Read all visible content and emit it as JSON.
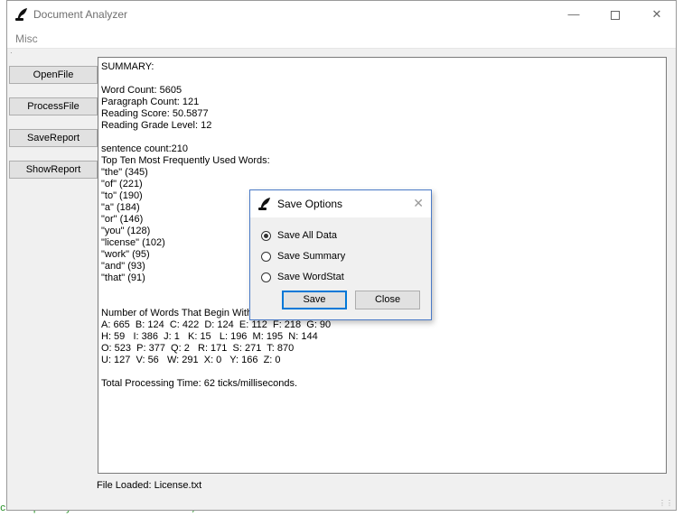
{
  "window": {
    "title": "Document Analyzer"
  },
  "menu": {
    "misc": "Misc"
  },
  "buttons": {
    "open_file": "OpenFile",
    "process_file": "ProcessFile",
    "save_report": "SaveReport",
    "show_report": "ShowReport"
  },
  "report": {
    "lines": [
      "SUMMARY:",
      "",
      "Word Count: 5605",
      "Paragraph Count: 121",
      "Reading Score: 50.5877",
      "Reading Grade Level: 12",
      "",
      "sentence count:210",
      "Top Ten Most Frequently Used Words:",
      "\"the\" (345)",
      "\"of\" (221)",
      "\"to\" (190)",
      "\"a\" (184)",
      "\"or\" (146)",
      "\"you\" (128)",
      "\"license\" (102)",
      "\"work\" (95)",
      "\"and\" (93)",
      "\"that\" (91)",
      "",
      "",
      "Number of Words That Begin With",
      "A: 665  B: 124  C: 422  D: 124  E: 112  F: 218  G: 90",
      "H: 59   I: 386  J: 1   K: 15   L: 196  M: 195  N: 144",
      "O: 523  P: 377  Q: 2   R: 171  S: 271  T: 870",
      "U: 127  V: 56   W: 291  X: 0   Y: 166  Z: 0",
      "",
      "Total Processing Time: 62 ticks/milliseconds."
    ]
  },
  "status": {
    "file_loaded": "File Loaded: License.txt"
  },
  "dialog": {
    "title": "Save Options",
    "options": [
      "Save All Data",
      "Save Summary",
      "Save WordStat"
    ],
    "selected": "Save All Data",
    "save": "Save",
    "close": "Close"
  },
  "background": {
    "bottom_code": "c frequently used words:  <<endl;"
  }
}
